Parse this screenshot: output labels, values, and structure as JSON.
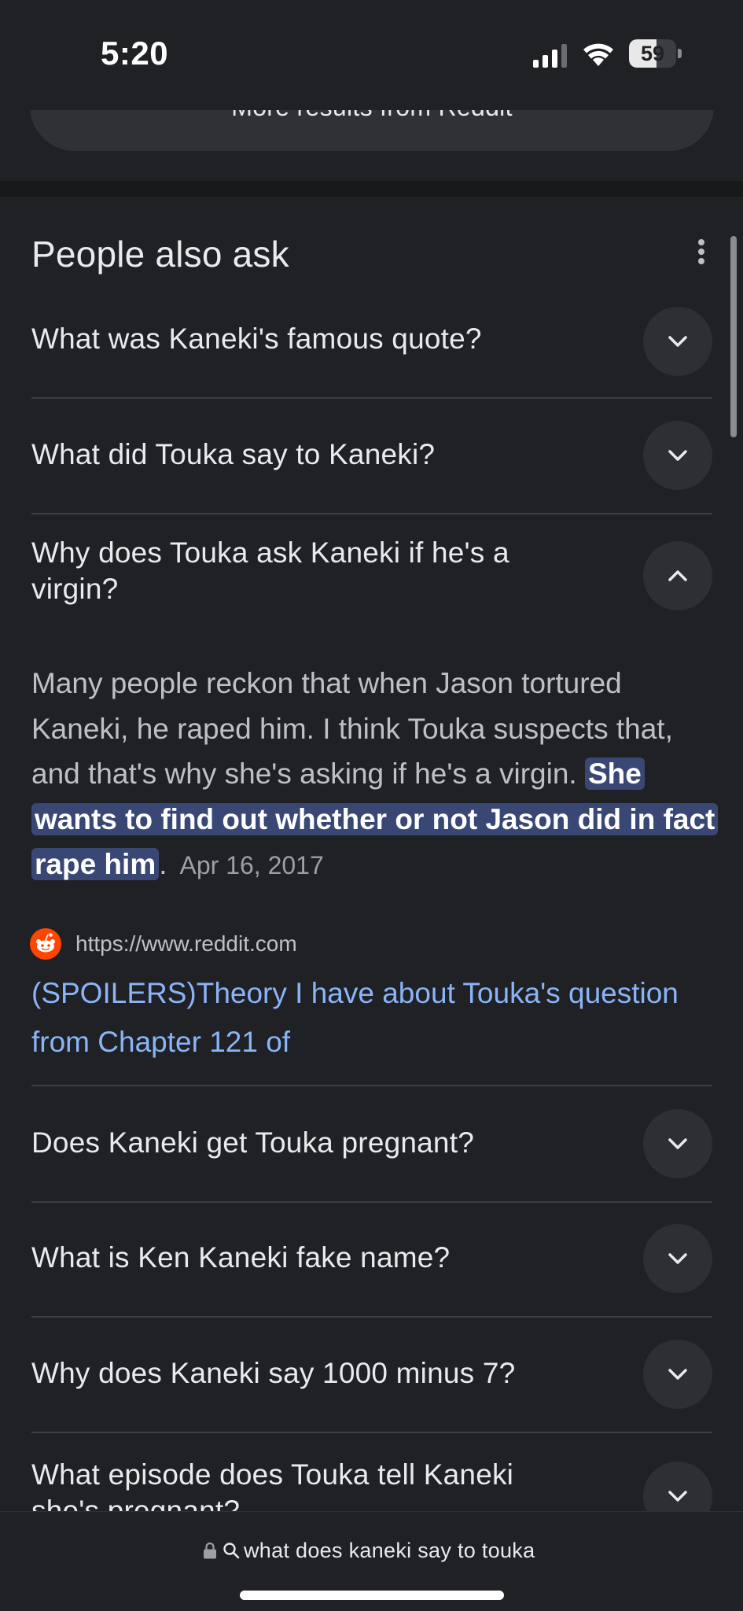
{
  "status_bar": {
    "time": "5:20",
    "battery": "59",
    "battery_level": 0.59
  },
  "more_results": {
    "label": "More results from Reddit"
  },
  "people_also_ask": {
    "title": "People also ask",
    "questions": [
      {
        "text": "What was Kaneki's famous quote?",
        "expanded": false
      },
      {
        "text": "What did Touka say to Kaneki?",
        "expanded": false
      },
      {
        "text": "Why does Touka ask Kaneki if he's a virgin?",
        "expanded": true
      },
      {
        "text": "Does Kaneki get Touka pregnant?",
        "expanded": false
      },
      {
        "text": "What is Ken Kaneki fake name?",
        "expanded": false
      },
      {
        "text": "Why does Kaneki say 1000 minus 7?",
        "expanded": false
      },
      {
        "text": "What episode does Touka tell Kaneki she's pregnant?",
        "expanded": false
      }
    ],
    "answer": {
      "text": "Many people reckon that when Jason tortured Kaneki, he raped him. I think Touka suspects that, and that's why she's asking if he's a virgin. ",
      "highlight": "She wants to find out whether or not Jason did in fact rape him",
      "end": ".",
      "date": "Apr 16, 2017",
      "source_url": "https://www.reddit.com",
      "link_title": "(SPOILERS)Theory I have about Touka's question from Chapter 121 of"
    }
  },
  "address_bar": {
    "query": "what does kaneki say to touka"
  },
  "colors": {
    "background": "#202124",
    "link": "#8ab4f8",
    "highlight": "#394775",
    "reddit": "#ff4500"
  }
}
